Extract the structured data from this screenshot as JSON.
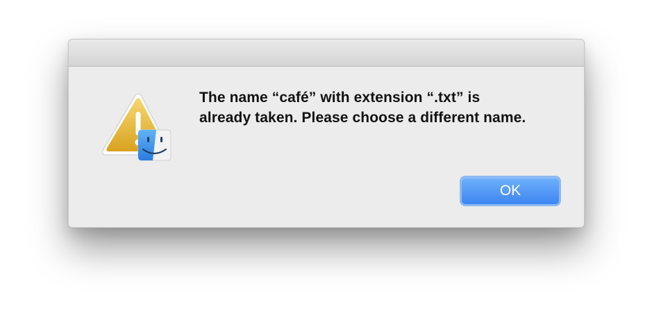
{
  "dialog": {
    "message": "The name “café” with extension “.txt” is already taken. Please choose a different name.",
    "ok_label": "OK"
  },
  "icons": {
    "alert": "warning-triangle-icon",
    "badge": "finder-icon"
  },
  "colors": {
    "dialog_background": "#ececec",
    "button_accent": "#4a90f5",
    "warning_yellow": "#e8b931"
  }
}
